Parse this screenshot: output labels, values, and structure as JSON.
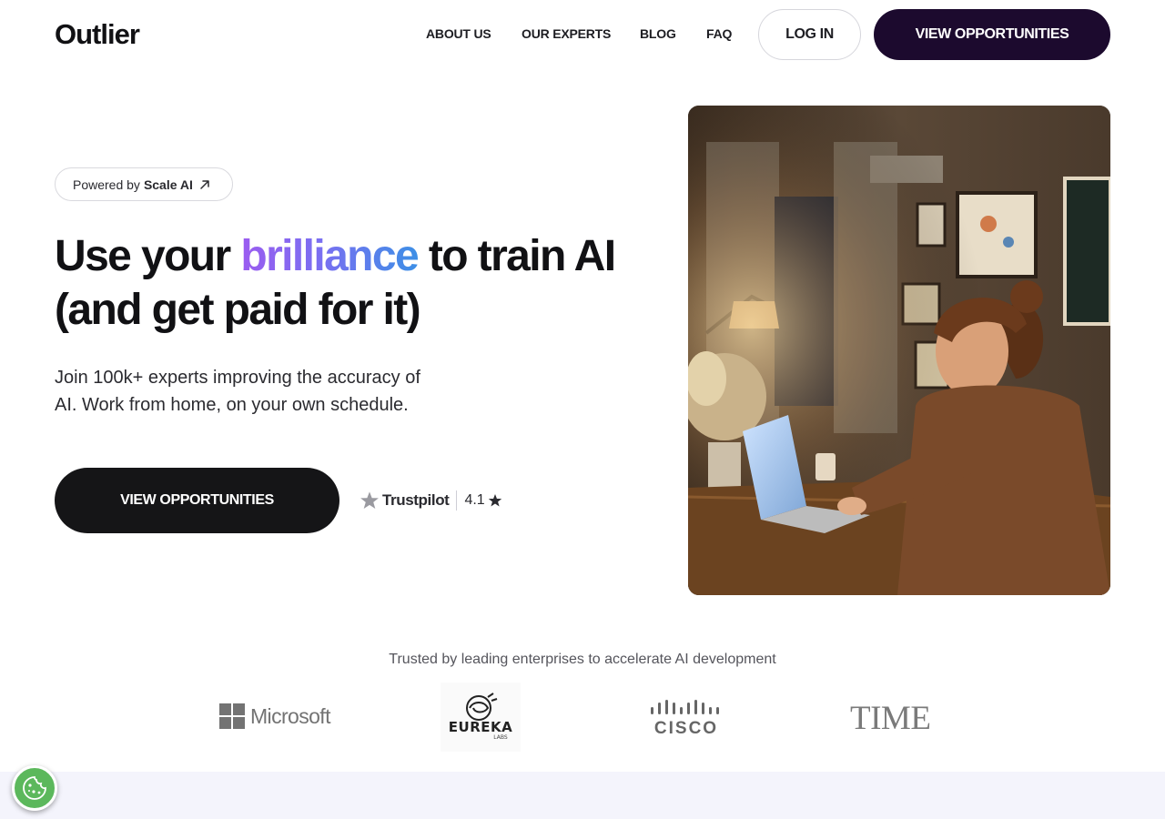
{
  "header": {
    "logo": "Outlier",
    "nav": [
      "ABOUT US",
      "OUR EXPERTS",
      "BLOG",
      "FAQ"
    ],
    "login_label": "LOG IN",
    "cta_label": "VIEW OPPORTUNITIES"
  },
  "hero": {
    "powered_prefix": "Powered by",
    "powered_brand": "Scale AI",
    "headline_before": "Use your ",
    "headline_highlight": "brilliance",
    "headline_after": " to train AI (and get paid for it)",
    "subtext": "Join 100k+ experts improving the accuracy of AI. Work from home, on your own schedule.",
    "cta_label": "VIEW OPPORTUNITIES",
    "trustpilot_name": "Trustpilot",
    "trustpilot_rating": "4.1"
  },
  "trusted": {
    "caption": "Trusted by leading enterprises to accelerate AI development",
    "logos": {
      "microsoft": "Microsoft",
      "eureka": "EUREKA",
      "eureka_sub": "LABS",
      "cisco": "CISCO",
      "time": "TIME"
    }
  },
  "colors": {
    "primary_dark": "#1c0a2e",
    "button_dark": "#151517",
    "gradient_start": "#9b5cf0",
    "gradient_end": "#3d8fe6",
    "cookie_green": "#5cb85c",
    "band": "#f4f4fc"
  },
  "icons": {
    "powered_arrow": "arrow-up-right-icon",
    "trustpilot_star": "star-icon",
    "rating_star": "star-icon",
    "cookie": "cookie-icon"
  }
}
